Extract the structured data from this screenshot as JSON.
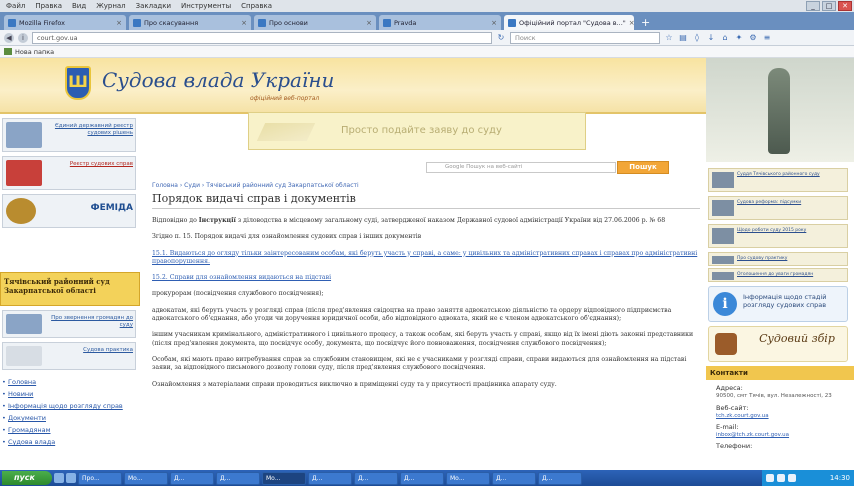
{
  "browser": {
    "menu": [
      "Файл",
      "Правка",
      "Вид",
      "Журнал",
      "Закладки",
      "Инструменты",
      "Справка"
    ],
    "tabs": [
      {
        "label": "Mozilla Firefox"
      },
      {
        "label": "Про скасування"
      },
      {
        "label": "Про основи"
      },
      {
        "label": "Pravda"
      },
      {
        "label": "Офіційний портал \"Судова в...\"",
        "active": true
      }
    ],
    "url": "court.gov.ua",
    "search_placeholder": "Поиск",
    "bookmark": "Нова папка"
  },
  "site": {
    "title": "Судова влада України",
    "subtitle": "офіційний веб-портал",
    "slogan": "Просто подайте заяву до суду",
    "search_placeholder": "Google Пошук на веб-сайті",
    "search_button": "Пошук"
  },
  "left": {
    "banners": [
      {
        "text": "Єдиний державний реєстр судових рішень",
        "style": "blue"
      },
      {
        "text": "Реєстр судових справ",
        "style": "red"
      },
      {
        "text": "ФЕМІДА",
        "style": "gold"
      }
    ],
    "court_name": "Тячівський районний суд Закарпатської області",
    "banners2": [
      {
        "text": "Про звернення громадян до суду",
        "style": "blue"
      },
      {
        "text": "Судова практика",
        "style": "blue"
      }
    ],
    "links": [
      "Головна",
      "Новини",
      "Інформація щодо розгляду справ",
      "Документи",
      "Громадянам",
      "Судова влада"
    ]
  },
  "content": {
    "breadcrumb": "Головна › Суди › Тячівський районний суд Закарпатської області",
    "title": "Порядок видачі справ і документів",
    "p1_lead": "Відповідно до",
    "p1_bold": "Інструкції",
    "p1_rest": "з діловодства в місцевому загальному суді, затвердженої наказом Державної судової адміністрації України від 27.06.2006 р. № 68",
    "p2": "Згідно п. 15. Порядок видачі для ознайомлення судових справ і інших документів",
    "p3": "15.1. Видаються до огляду тільки заінтересованим особам, які беруть участь у справі, а саме: у цивільних та адміністративних справах і справах про адміністративні правопорушення.",
    "p4": "15.2. Справи для ознайомлення видаються на підставі",
    "p5": "прокурорам (посвідчення службового посвідчення);",
    "p6": "адвокатам, які беруть участь у розгляді справ (після пред'явлення свідоцтва на право заняття адвокатською діяльністю та ордеру відповідного підприємства адвокатського об'єднання, або угоди чи доручення юридичної особи, або відповідного адвоката, який не є членом адвокатського об'єднання);",
    "p7": "іншим учасникам кримінального, адміністративного і цивільного процесу, а також особам, які беруть участь у справі, якщо від їх імені діють законні представники (після пред'явлення документа, що посвідчує особу, документа, що посвідчує його повноваження, посвідчення службового посвідчення);",
    "p8": "Особам, які мають право витребування справ за службовим становищем, які не є учасниками у розгляді справи, справи видаються для ознайомлення на підставі заяви, за відповідного письмового дозволу голови суду, після пред'явлення службового посвідчення.",
    "p9": "Ознайомлення з матеріалами справи проводиться виключно в приміщенні суду та у присутності працівника апарату суду."
  },
  "right": {
    "news": [
      "Суддя Тячівського районного суду",
      "Судова реформа: підсумки",
      "Щодо роботи суду 2015 року",
      "Про судову практику",
      "Оголошення до уваги громадян"
    ],
    "info": "Інформація щодо стадій розгляду судових справ",
    "fund": "Судовий збір",
    "contacts": {
      "heading": "Контакти",
      "address_label": "Адреса:",
      "address": "90500, смт Тячів, вул. Незалежності, 23",
      "web_label": "Веб-сайт:",
      "web": "tch.zk.court.gov.ua",
      "email_label": "E-mail:",
      "email": "inbox@tch.zk.court.gov.ua",
      "phone_label": "Телефони:"
    }
  },
  "taskbar": {
    "start": "пуск",
    "buttons": [
      "Про...",
      "Мо...",
      "Д...",
      "Д...",
      "Мо...",
      "Д...",
      "Д...",
      "Д...",
      "Мо...",
      "Д...",
      "Д..."
    ],
    "clock": "14:30"
  }
}
